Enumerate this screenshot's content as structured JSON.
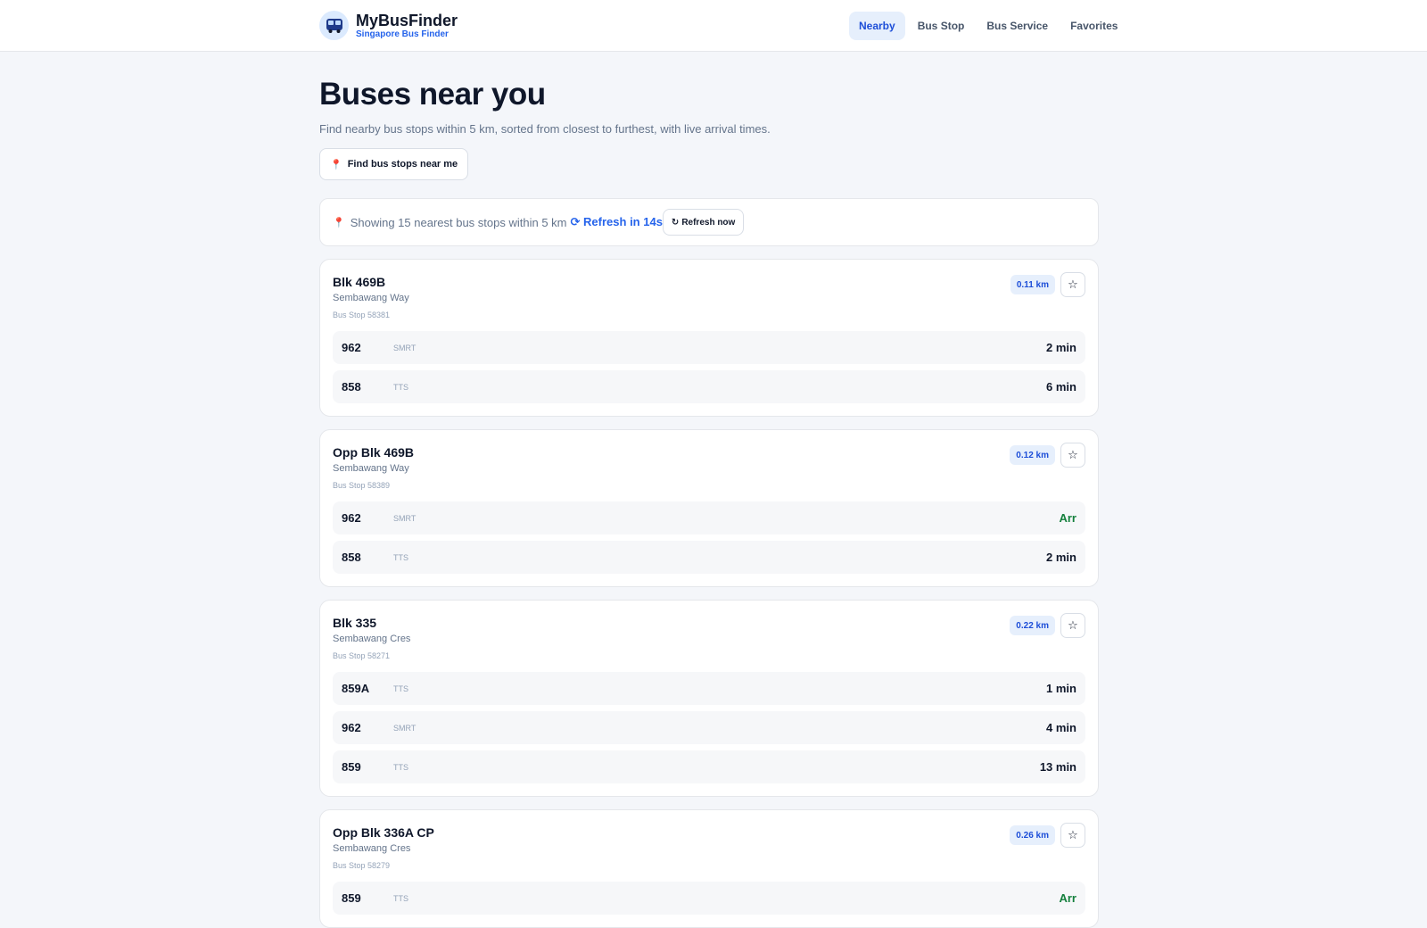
{
  "header": {
    "brand_name": "MyBusFinder",
    "brand_tagline": "Singapore Bus Finder",
    "logo_icon": "bus-icon",
    "nav": [
      {
        "label": "Nearby",
        "active": true
      },
      {
        "label": "Bus Stop",
        "active": false
      },
      {
        "label": "Bus Service",
        "active": false
      },
      {
        "label": "Favorites",
        "active": false
      }
    ]
  },
  "page": {
    "title": "Buses near you",
    "subtitle": "Find nearby bus stops within 5 km, sorted from closest to furthest, with live arrival times.",
    "find_button": "Find bus stops near me"
  },
  "status": {
    "text": "Showing 15 nearest bus stops within 5 km",
    "countdown": "Refresh in 14s",
    "refresh_button": "Refresh now"
  },
  "stops": [
    {
      "name": "Blk 469B",
      "road": "Sembawang Way",
      "code": "Bus Stop 58381",
      "distance": "0.11 km",
      "services": [
        {
          "number": "962",
          "operator": "SMRT",
          "eta": "2 min"
        },
        {
          "number": "858",
          "operator": "TTS",
          "eta": "6 min"
        }
      ]
    },
    {
      "name": "Opp Blk 469B",
      "road": "Sembawang Way",
      "code": "Bus Stop 58389",
      "distance": "0.12 km",
      "services": [
        {
          "number": "962",
          "operator": "SMRT",
          "eta": "Arr"
        },
        {
          "number": "858",
          "operator": "TTS",
          "eta": "2 min"
        }
      ]
    },
    {
      "name": "Blk 335",
      "road": "Sembawang Cres",
      "code": "Bus Stop 58271",
      "distance": "0.22 km",
      "services": [
        {
          "number": "859A",
          "operator": "TTS",
          "eta": "1 min"
        },
        {
          "number": "962",
          "operator": "SMRT",
          "eta": "4 min"
        },
        {
          "number": "859",
          "operator": "TTS",
          "eta": "13 min"
        }
      ]
    },
    {
      "name": "Opp Blk 336A CP",
      "road": "Sembawang Cres",
      "code": "Bus Stop 58279",
      "distance": "0.26 km",
      "services": [
        {
          "number": "859",
          "operator": "TTS",
          "eta": "Arr"
        }
      ]
    }
  ],
  "colors": {
    "accent": "#2563eb",
    "arriving": "#15803d",
    "pin": "#e11d48"
  }
}
